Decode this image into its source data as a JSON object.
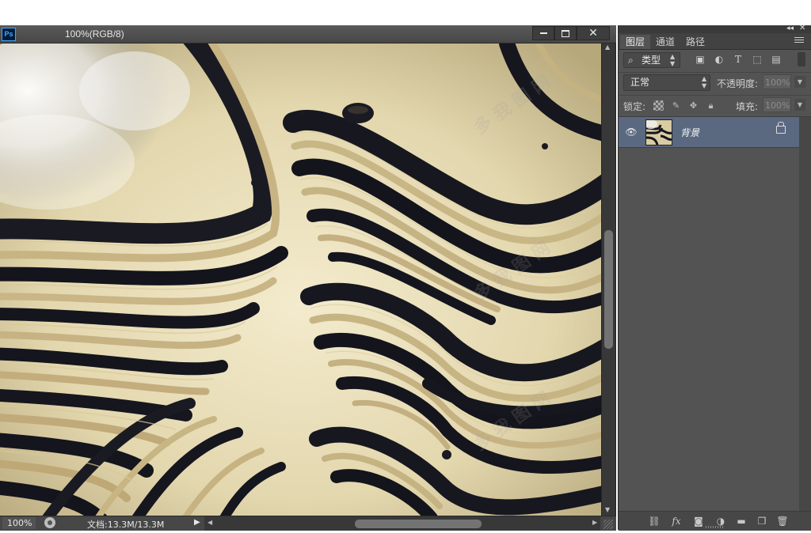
{
  "app": {
    "logo_text": "Ps"
  },
  "document": {
    "title": "100%(RGB/8)",
    "zoom": "100%",
    "doc_size": "文档:13.3M/13.3M"
  },
  "layers_panel": {
    "tabs": [
      {
        "label": "图层"
      },
      {
        "label": "通道"
      },
      {
        "label": "路径"
      }
    ],
    "filter": {
      "label": "类型"
    },
    "blend_mode": "正常",
    "opacity_label": "不透明度:",
    "opacity_value": "100%",
    "lock_label": "锁定:",
    "fill_label": "填充:",
    "fill_value": "100%",
    "layers": [
      {
        "name": "背景",
        "visible": true,
        "locked": true,
        "selected": true
      }
    ]
  },
  "icons": {
    "filter_image": "image-filter-icon",
    "filter_adjust": "adjustment-filter-icon",
    "filter_type": "type-filter-icon",
    "filter_shape": "shape-filter-icon",
    "filter_smart": "smart-object-filter-icon"
  },
  "colors": {
    "ui_dark": "#535353",
    "selected_layer": "#5a6880",
    "canvas_light": "#e9dfbd",
    "canvas_dark": "#141420"
  }
}
